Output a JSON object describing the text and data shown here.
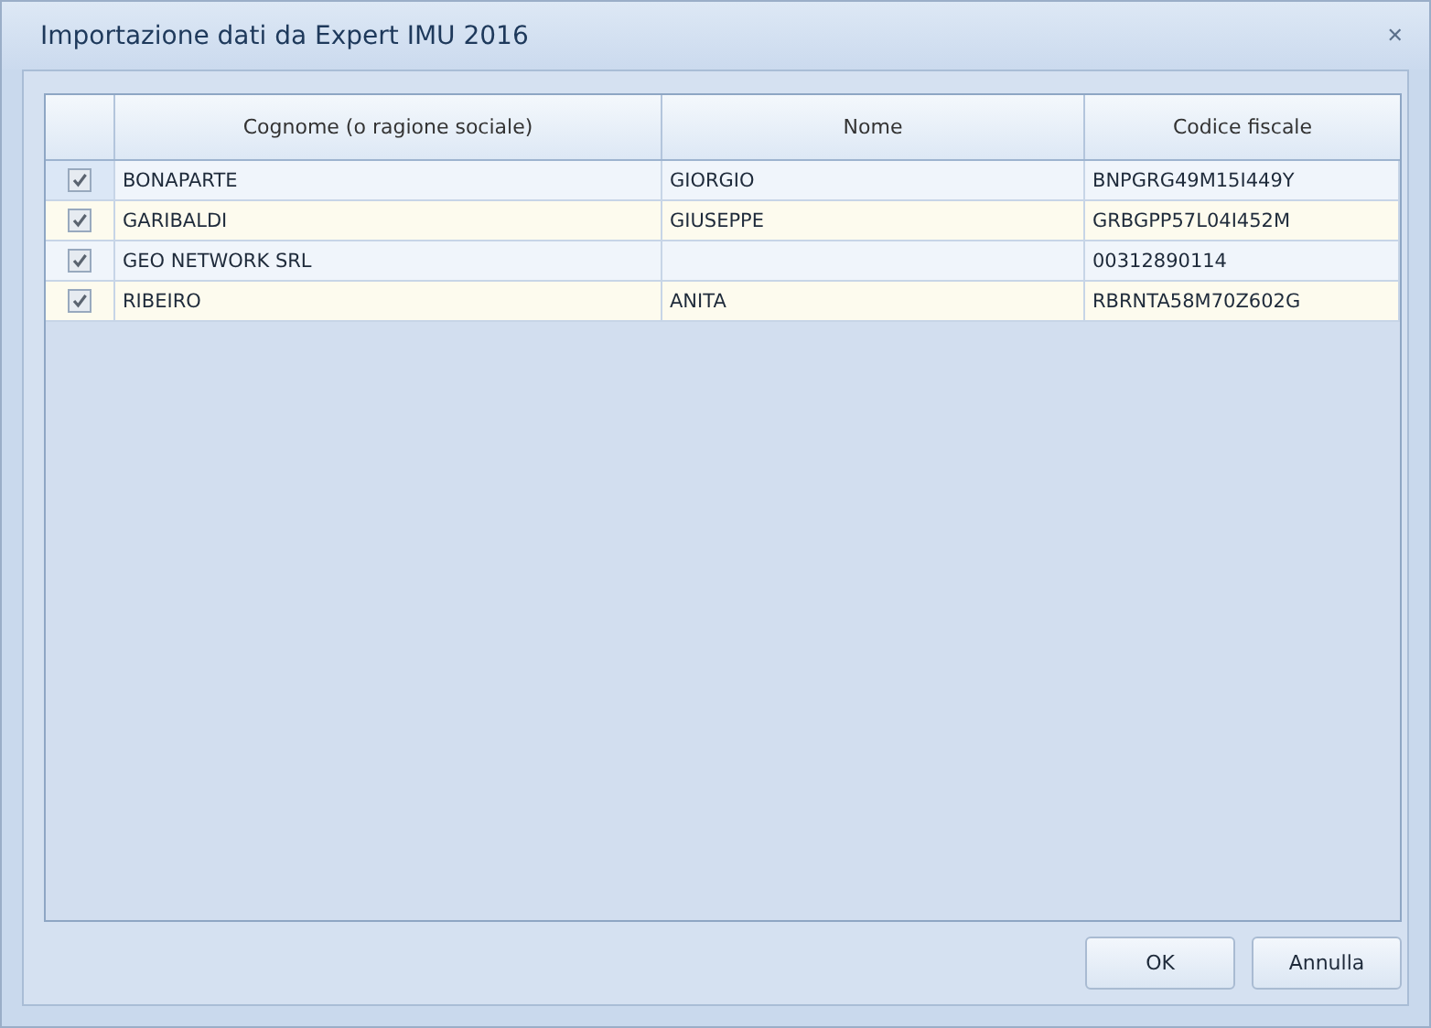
{
  "window": {
    "title": "Importazione dati da Expert IMU 2016",
    "close": "✕"
  },
  "table": {
    "columns": [
      "Cognome (o ragione sociale)",
      "Nome",
      "Codice fiscale"
    ],
    "rows": [
      {
        "checked": true,
        "selected": true,
        "cells": [
          "BONAPARTE",
          "GIORGIO",
          "BNPGRG49M15I449Y"
        ]
      },
      {
        "checked": true,
        "selected": false,
        "cells": [
          "GARIBALDI",
          "GIUSEPPE",
          "GRBGPP57L04I452M"
        ]
      },
      {
        "checked": true,
        "selected": false,
        "cells": [
          "GEO NETWORK SRL",
          "",
          "00312890114"
        ]
      },
      {
        "checked": true,
        "selected": false,
        "cells": [
          "RIBEIRO",
          "ANITA",
          "RBRNTA58M70Z602G"
        ]
      }
    ]
  },
  "buttons": [
    "OK",
    "Annulla"
  ]
}
